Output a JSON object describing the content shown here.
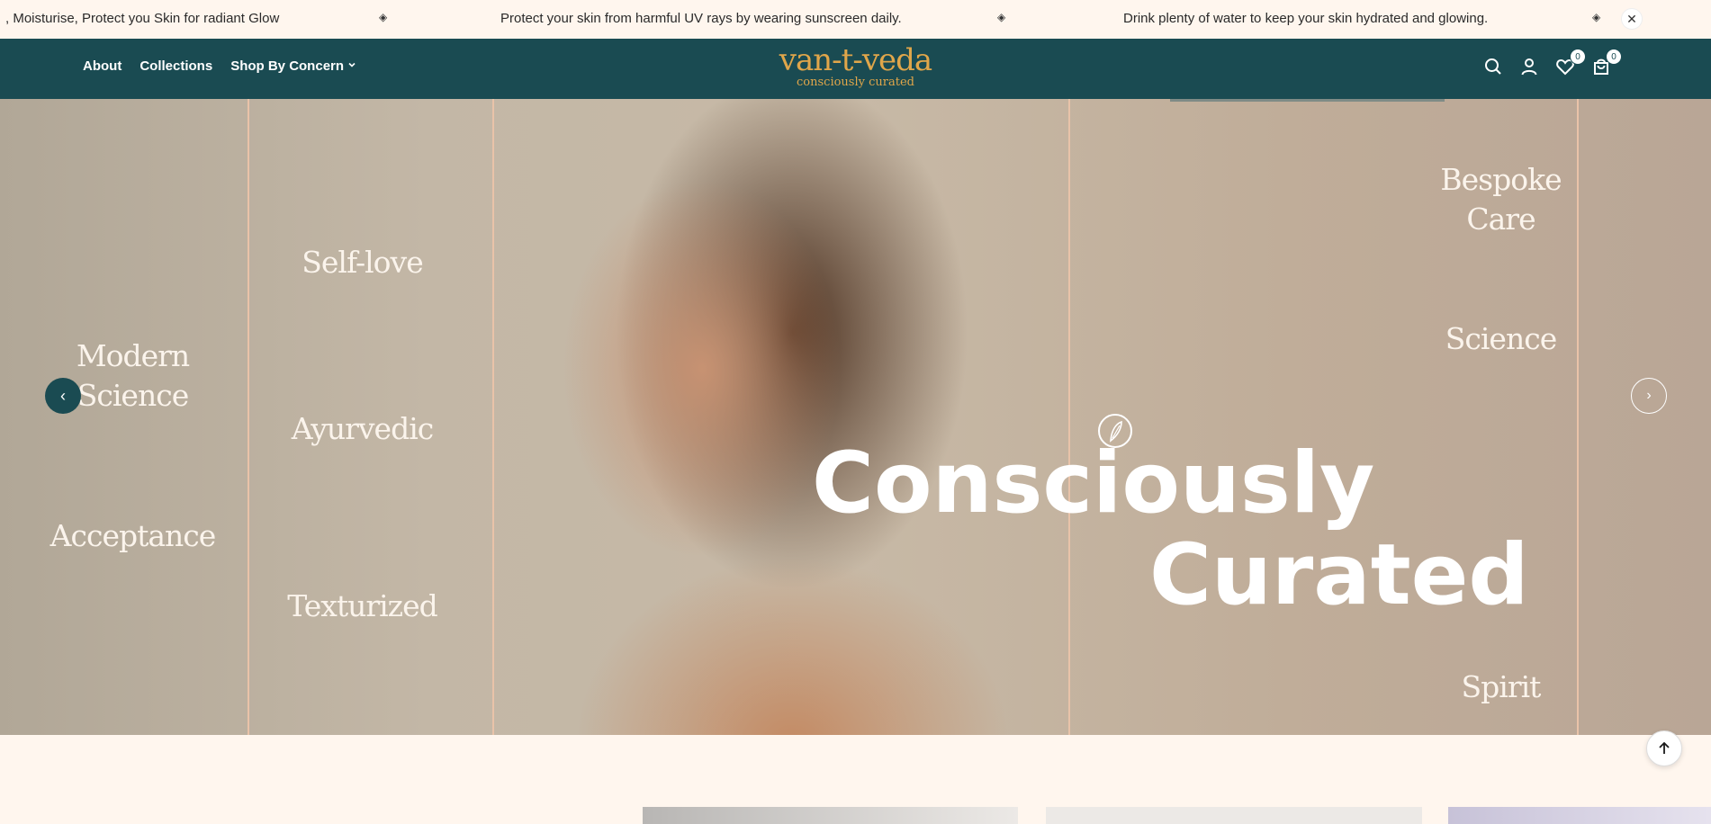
{
  "announcement": {
    "messages": [
      ", Moisturise, Protect you Skin for radiant Glow",
      "Protect your skin from harmful UV rays by wearing sunscreen daily.",
      "Drink plenty of water to keep your skin hydrated and glowing."
    ],
    "close_icon": "close-icon"
  },
  "header": {
    "nav": [
      "About",
      "Collections",
      "Shop By Concern"
    ],
    "logo": {
      "word": "van-t-veda",
      "tagline": "consciously curated"
    },
    "wishlist_count": "0",
    "cart_count": "0"
  },
  "hero": {
    "col1": [
      "Modern Science",
      "Acceptance"
    ],
    "col2": [
      "Self-love",
      "Ayurvedic",
      "Texturized"
    ],
    "col5": [
      "Bespoke Care",
      "Science",
      "Spirit"
    ],
    "headline": [
      "Consciously",
      "Curated"
    ]
  },
  "colors": {
    "primary": "#1a4b52",
    "accent": "#e0a64a",
    "background": "#fff6ee"
  }
}
